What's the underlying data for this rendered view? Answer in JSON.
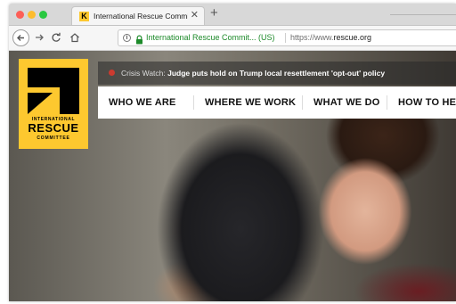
{
  "browser": {
    "tab": {
      "favicon_letter": "K",
      "title": "International Rescue Committee",
      "close_glyph": "✕"
    },
    "new_tab_glyph": "+",
    "address_bar": {
      "site_identity": "International Rescue Commit... (US)",
      "url_prefix": "https://www.",
      "url_domain": "rescue.org"
    }
  },
  "page": {
    "alert": {
      "lead": "Crisis Watch:",
      "headline": "Judge puts hold on Trump local resettlement 'opt-out' policy"
    },
    "logo": {
      "line1": "INTERNATIONAL",
      "line2": "RESCUE",
      "line3": "COMMITTEE",
      "color": "#fdc82f"
    },
    "nav": [
      {
        "label": "WHO WE ARE"
      },
      {
        "label": "WHERE WE WORK"
      },
      {
        "label": "WHAT WE DO"
      },
      {
        "label": "HOW TO HELP"
      }
    ]
  },
  "icons": {
    "back": "back-arrow-icon",
    "forward": "forward-arrow-icon",
    "reload": "reload-icon",
    "home": "home-icon",
    "info": "info-icon",
    "lock": "lock-icon",
    "alert": "alert-dot-icon"
  }
}
